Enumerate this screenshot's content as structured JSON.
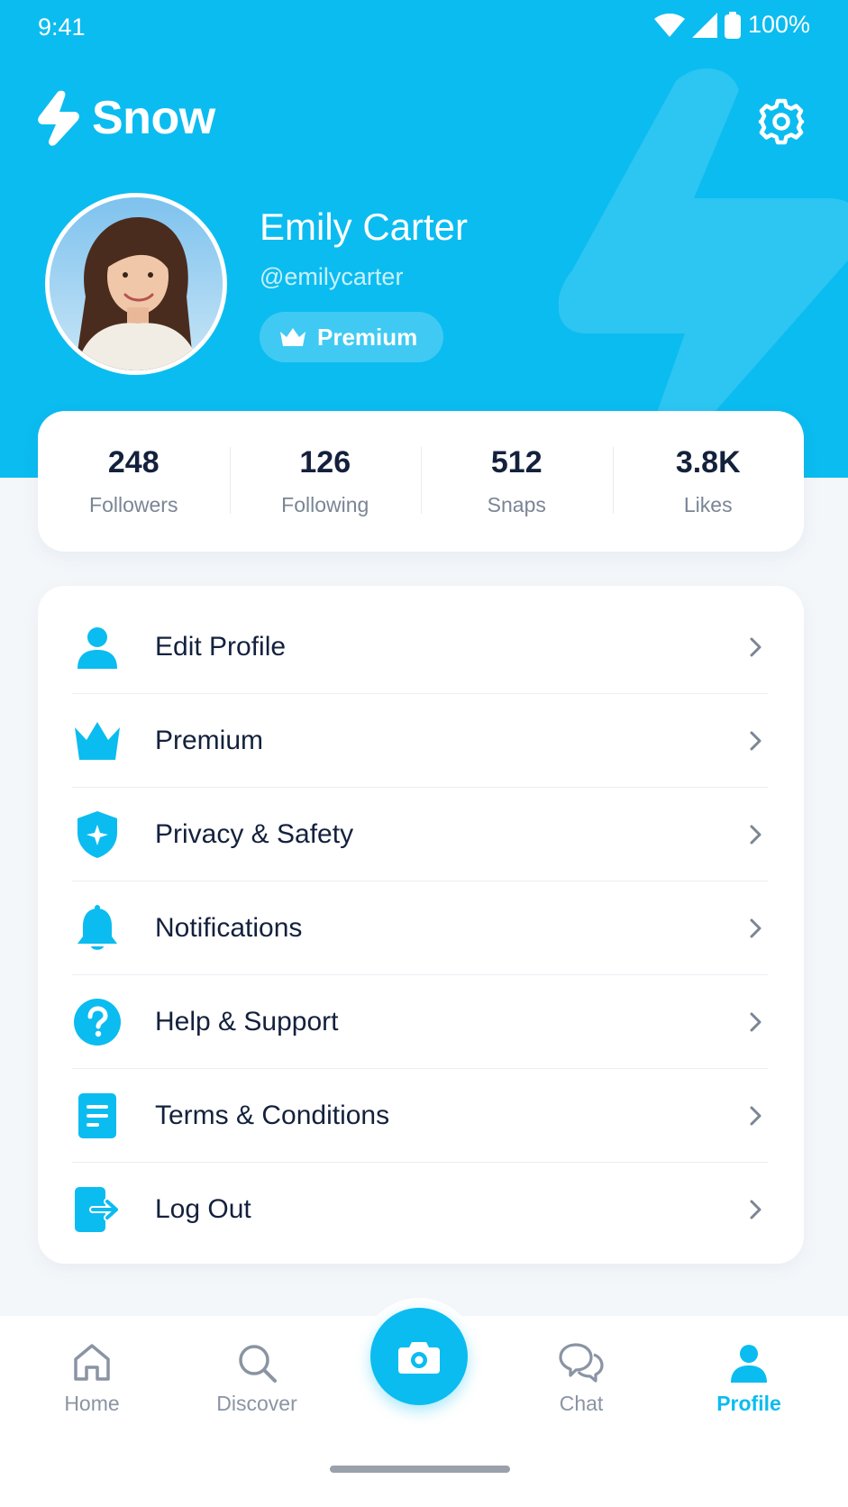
{
  "status_bar": {
    "time": "9:41",
    "battery": "100%"
  },
  "brand": {
    "name": "Snow"
  },
  "profile": {
    "name": "Emily Carter",
    "handle": "@emilycarter",
    "badge": "Premium"
  },
  "stats": [
    {
      "value": "248",
      "label": "Followers"
    },
    {
      "value": "126",
      "label": "Following"
    },
    {
      "value": "512",
      "label": "Snaps"
    },
    {
      "value": "3.8K",
      "label": "Likes"
    }
  ],
  "menu": [
    {
      "label": "Edit Profile",
      "icon": "person-icon"
    },
    {
      "label": "Premium",
      "icon": "crown-icon"
    },
    {
      "label": "Privacy & Safety",
      "icon": "shield-icon"
    },
    {
      "label": "Notifications",
      "icon": "bell-icon"
    },
    {
      "label": "Help & Support",
      "icon": "help-icon"
    },
    {
      "label": "Terms & Conditions",
      "icon": "document-icon"
    },
    {
      "label": "Log Out",
      "icon": "logout-icon"
    }
  ],
  "bottom_nav": [
    {
      "label": "Home",
      "icon": "home-icon",
      "active": false
    },
    {
      "label": "Discover",
      "icon": "search-icon",
      "active": false
    },
    {
      "label": "Chat",
      "icon": "chat-icon",
      "active": false
    },
    {
      "label": "Profile",
      "icon": "person-icon",
      "active": true
    }
  ],
  "colors": {
    "accent": "#0bbcf0",
    "text": "#14213d",
    "muted": "#7a8595",
    "background": "#f4f7fa"
  }
}
